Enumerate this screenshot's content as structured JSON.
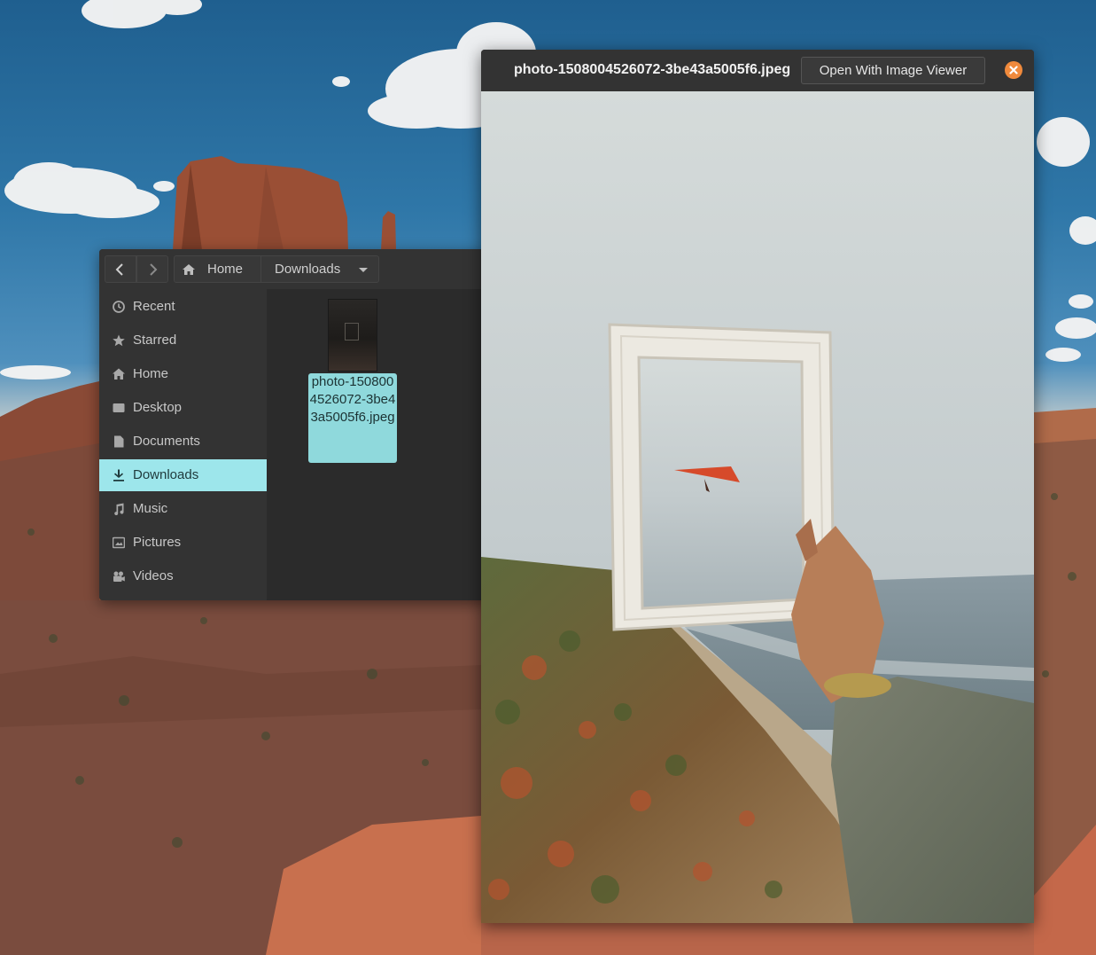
{
  "files": {
    "nav": {
      "back_icon": "chevron-left-icon",
      "forward_icon": "chevron-right-icon"
    },
    "pathbar": {
      "home_label": "Home",
      "current_label": "Downloads"
    },
    "sidebar": {
      "items": [
        {
          "label": "Recent",
          "icon": "clock-icon",
          "active": false
        },
        {
          "label": "Starred",
          "icon": "star-icon",
          "active": false
        },
        {
          "label": "Home",
          "icon": "home-icon",
          "active": false
        },
        {
          "label": "Desktop",
          "icon": "desktop-icon",
          "active": false
        },
        {
          "label": "Documents",
          "icon": "document-icon",
          "active": false
        },
        {
          "label": "Downloads",
          "icon": "download-icon",
          "active": true
        },
        {
          "label": "Music",
          "icon": "music-icon",
          "active": false
        },
        {
          "label": "Pictures",
          "icon": "picture-icon",
          "active": false
        },
        {
          "label": "Videos",
          "icon": "video-icon",
          "active": false
        }
      ]
    },
    "content": {
      "file_label": "photo-1508004526072-3be43a5005f6.jpeg"
    }
  },
  "preview": {
    "title": "photo-1508004526072-3be43a5005f6.jpeg",
    "open_button_label": "Open With Image Viewer",
    "close_icon": "close-icon",
    "accent_close_color": "#f08a3c"
  },
  "colors": {
    "selection": "#9de6eb",
    "window_bg": "#2b2b2b",
    "header_bg": "#333333"
  }
}
